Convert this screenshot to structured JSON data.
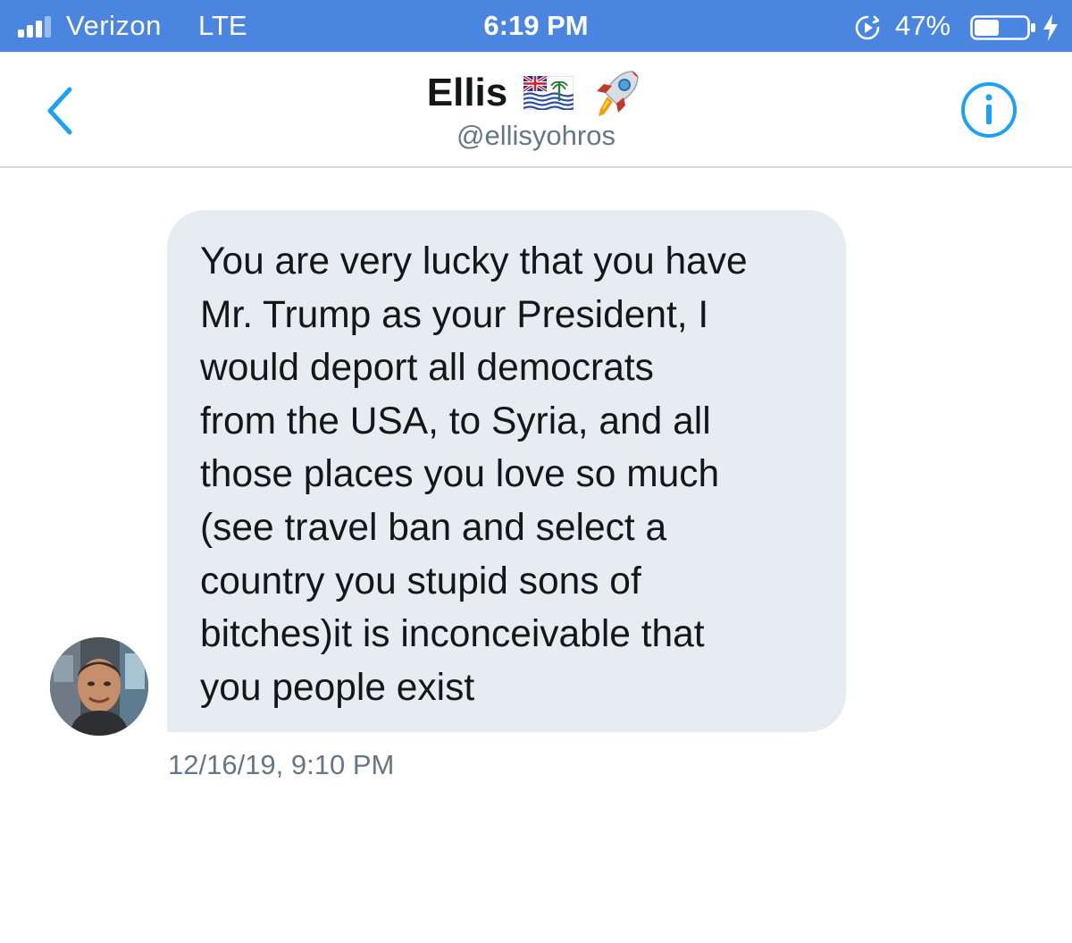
{
  "status_bar": {
    "carrier": "Verizon",
    "network": "LTE",
    "time": "6:19 PM",
    "battery_percent": "47%",
    "battery_level": 0.47,
    "background_color": "#4a86e0"
  },
  "header": {
    "name": "Ellis",
    "handle": "@ellisyohros",
    "icons": [
      "back-chevron-icon",
      "british-indian-ocean-territory-flag-icon",
      "rocket-icon",
      "info-icon"
    ],
    "accent_color": "#1da1f2"
  },
  "conversation": {
    "messages": [
      {
        "text": "You are very lucky that you have\nMr. Trump as your President, I\nwould  deport all democrats\nfrom the USA, to Syria, and all\nthose places you love so much\n(see travel ban and select a\ncountry you stupid sons of\nbitches)it is inconceivable that\nyou people exist",
        "timestamp": "12/16/19, 9:10 PM",
        "direction": "received",
        "bubble_color": "#e6ecf0"
      }
    ]
  }
}
